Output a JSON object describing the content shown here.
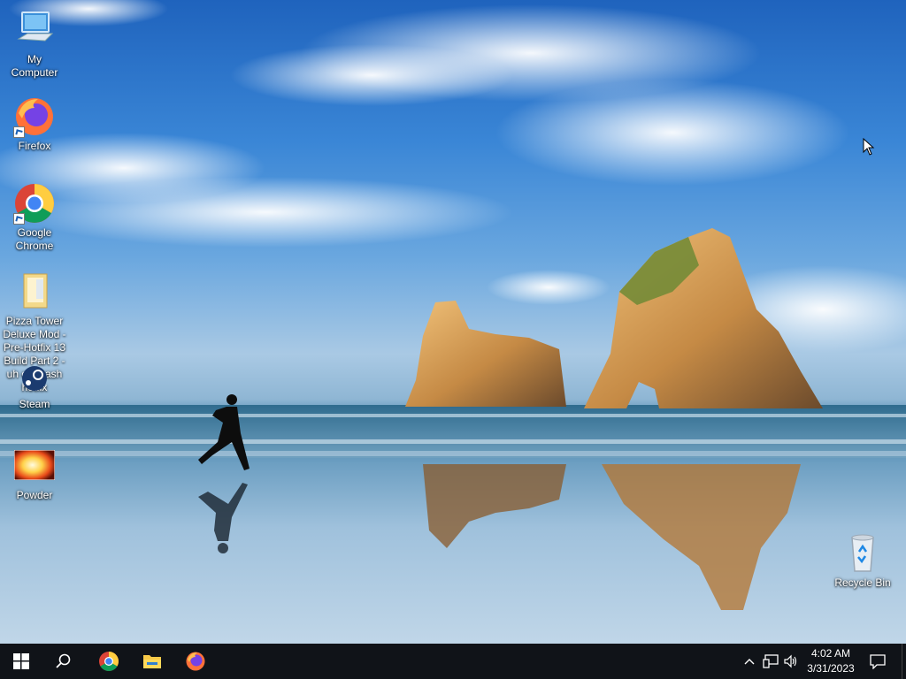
{
  "desktop": {
    "icons": [
      {
        "label": "My Computer",
        "icon": "computer-icon"
      },
      {
        "label": "Firefox",
        "icon": "firefox-icon"
      },
      {
        "label": "Google Chrome",
        "icon": "chrome-icon"
      },
      {
        "label": "Pizza Tower Deluxe Mod - Pre-Hotfix 13 Build Part 2 - uh oh crash hotfix",
        "icon": "folder-icon"
      },
      {
        "label": "Steam",
        "icon": "steam-icon"
      },
      {
        "label": "Powder",
        "icon": "powder-icon"
      },
      {
        "label": "Recycle Bin",
        "icon": "recycle-bin-icon"
      }
    ]
  },
  "taskbar": {
    "start": "windows-start-icon",
    "search": "search-icon",
    "pinned": [
      "chrome-icon",
      "file-explorer-icon",
      "firefox-icon"
    ],
    "tray": [
      "chevron-up-icon",
      "network-icon",
      "volume-icon"
    ],
    "clock": {
      "time": "4:02 AM",
      "date": "3/31/2023"
    },
    "notifications": "action-center-icon"
  },
  "colors": {
    "taskbar_bg": "#101318",
    "accent": "#1a5fb4"
  }
}
